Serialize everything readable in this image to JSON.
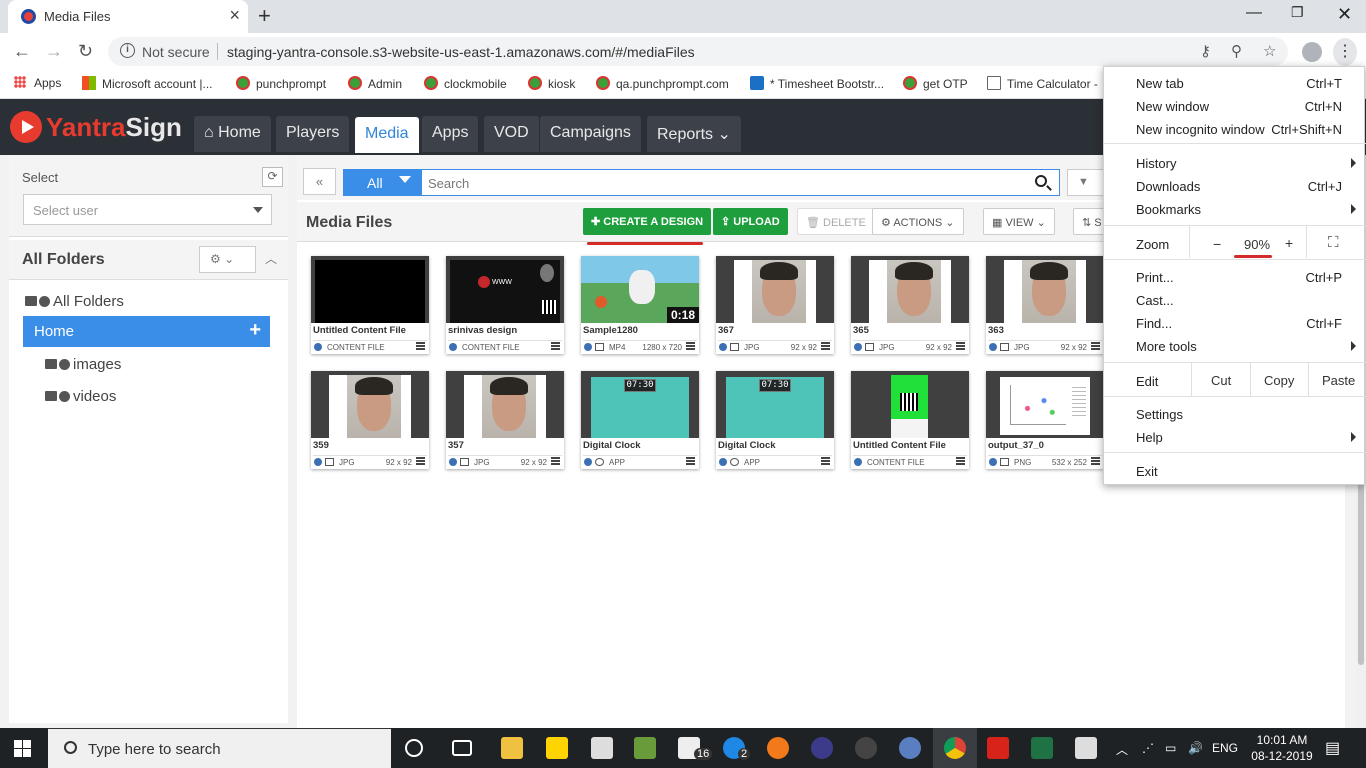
{
  "browser": {
    "tab_title": "Media Files",
    "not_secure": "Not secure",
    "url": "staging-yantra-console.s3-website-us-east-1.amazonaws.com/#/mediaFiles",
    "bookmarks": [
      "Apps",
      "Microsoft account |...",
      "punchprompt",
      "Admin",
      "clockmobile",
      "kiosk",
      "qa.punchprompt.com",
      "* Timesheet Bootstr...",
      "get OTP",
      "Time Calculator -"
    ]
  },
  "app": {
    "logo_part1": "Yantra",
    "logo_part2": "Sign",
    "nav": [
      "Home",
      "Players",
      "Media",
      "Apps",
      "VOD",
      "Campaigns",
      "Reports"
    ],
    "accent": "#2f86d8",
    "brand_red": "#e63b2e"
  },
  "left": {
    "select_label": "Select",
    "select_placeholder": "Select user",
    "all_folders_heading": "All Folders",
    "tree_root": "All Folders",
    "tree_home": "Home",
    "tree_children": [
      "images",
      "videos"
    ]
  },
  "main": {
    "back": "«",
    "filter_all": "All",
    "search_placeholder": "Search",
    "title": "Media Files",
    "buttons": {
      "create": "CREATE A DESIGN",
      "upload": "UPLOAD",
      "delete": "DELETE",
      "actions": "ACTIONS",
      "view": "VIEW",
      "sort": "S"
    },
    "cards": [
      {
        "name": "Untitled Content File",
        "type": "CONTENT FILE",
        "dim": ""
      },
      {
        "name": "srinivas design",
        "type": "CONTENT FILE",
        "dim": ""
      },
      {
        "name": "Sample1280",
        "type": "MP4",
        "dim": "1280 x 720",
        "duration": "0:18"
      },
      {
        "name": "367",
        "type": "JPG",
        "dim": "92 x 92"
      },
      {
        "name": "365",
        "type": "JPG",
        "dim": "92 x 92"
      },
      {
        "name": "363",
        "type": "JPG",
        "dim": "92 x 92"
      },
      {
        "name": "359",
        "type": "JPG",
        "dim": "92 x 92"
      },
      {
        "name": "357",
        "type": "JPG",
        "dim": "92 x 92"
      },
      {
        "name": "Digital Clock",
        "type": "APP",
        "dim": "",
        "clock": "07:30"
      },
      {
        "name": "Digital Clock",
        "type": "APP",
        "dim": "",
        "clock": "07:30"
      },
      {
        "name": "Untitled Content File",
        "type": "CONTENT FILE",
        "dim": ""
      },
      {
        "name": "output_37_0",
        "type": "PNG",
        "dim": "532 x 252"
      }
    ]
  },
  "chrome_menu": {
    "new_tab": "New tab",
    "new_tab_sc": "Ctrl+T",
    "new_window": "New window",
    "new_window_sc": "Ctrl+N",
    "incognito": "New incognito window",
    "incognito_sc": "Ctrl+Shift+N",
    "history": "History",
    "downloads": "Downloads",
    "downloads_sc": "Ctrl+J",
    "bookmarks": "Bookmarks",
    "zoom": "Zoom",
    "zoom_minus": "−",
    "zoom_value": "90%",
    "zoom_plus": "+",
    "print": "Print...",
    "print_sc": "Ctrl+P",
    "cast": "Cast...",
    "find": "Find...",
    "find_sc": "Ctrl+F",
    "more_tools": "More tools",
    "edit": "Edit",
    "cut": "Cut",
    "copy": "Copy",
    "paste": "Paste",
    "settings": "Settings",
    "help": "Help",
    "exit": "Exit"
  },
  "taskbar": {
    "search_placeholder": "Type here to search",
    "mail_badge": "16",
    "skype_badge": "2",
    "lang": "ENG",
    "time": "10:01 AM",
    "date": "08-12-2019"
  }
}
